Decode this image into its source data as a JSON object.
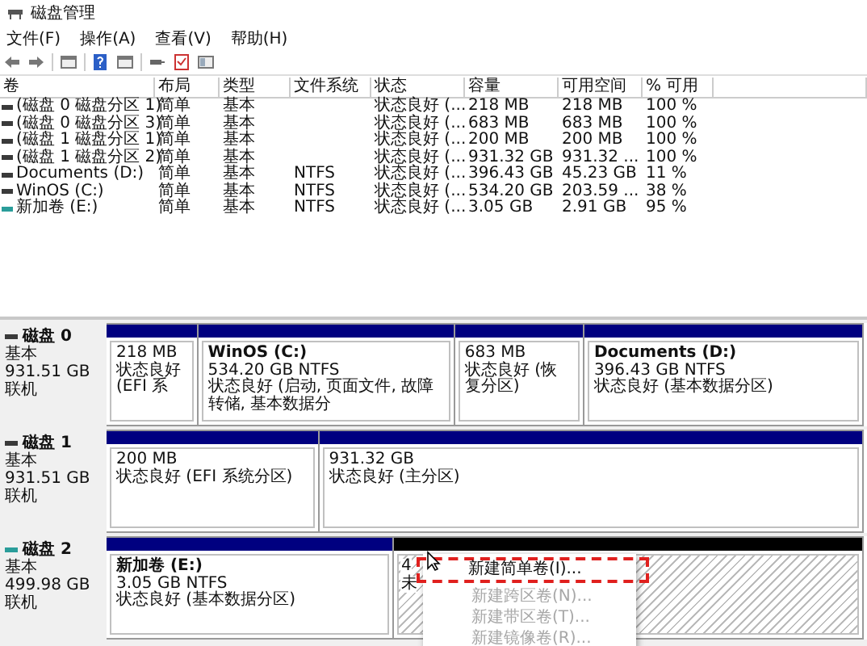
{
  "window": {
    "title": "磁盘管理"
  },
  "menu": [
    "文件(F)",
    "操作(A)",
    "查看(V)",
    "帮助(H)"
  ],
  "table": {
    "columns": [
      "卷",
      "布局",
      "类型",
      "文件系统",
      "状态",
      "容量",
      "可用空间",
      "% 可用"
    ],
    "rows": [
      {
        "color": "#3a3a3a",
        "cells": [
          "(磁盘 0 磁盘分区 1)",
          "简单",
          "基本",
          "",
          "状态良好 (...",
          "218 MB",
          "218 MB",
          "100 %"
        ]
      },
      {
        "color": "#3a3a3a",
        "cells": [
          "(磁盘 0 磁盘分区 3)",
          "简单",
          "基本",
          "",
          "状态良好 (...",
          "683 MB",
          "683 MB",
          "100 %"
        ]
      },
      {
        "color": "#3a3a3a",
        "cells": [
          "(磁盘 1 磁盘分区 1)",
          "简单",
          "基本",
          "",
          "状态良好 (...",
          "200 MB",
          "200 MB",
          "100 %"
        ]
      },
      {
        "color": "#3a3a3a",
        "cells": [
          "(磁盘 1 磁盘分区 2)",
          "简单",
          "基本",
          "",
          "状态良好 (...",
          "931.32 GB",
          "931.32 ...",
          "100 %"
        ]
      },
      {
        "color": "#3a3a3a",
        "cells": [
          "Documents (D:)",
          "简单",
          "基本",
          "NTFS",
          "状态良好 (...",
          "396.43 GB",
          "45.23 GB",
          "11 %"
        ]
      },
      {
        "color": "#3a3a3a",
        "cells": [
          "WinOS (C:)",
          "简单",
          "基本",
          "NTFS",
          "状态良好 (...",
          "534.20 GB",
          "203.59 ...",
          "38 %"
        ]
      },
      {
        "color": "#2a9d9a",
        "cells": [
          "新加卷 (E:)",
          "简单",
          "基本",
          "NTFS",
          "状态良好 (...",
          "3.05 GB",
          "2.91 GB",
          "95 %"
        ]
      }
    ]
  },
  "disks": [
    {
      "name": "磁盘 0",
      "color": "#3a3a3a",
      "type": "基本",
      "size": "931.51 GB",
      "status": "联机",
      "partitions": [
        {
          "kind": "primary",
          "lines": [
            "218 MB",
            "状态良好 (EFI 系"
          ]
        },
        {
          "kind": "primary",
          "title": "WinOS (C:)",
          "lines": [
            "534.20 GB NTFS",
            "状态良好 (启动, 页面文件, 故障转储, 基本数据分"
          ]
        },
        {
          "kind": "primary",
          "lines": [
            "683 MB",
            "状态良好 (恢复分区)"
          ]
        },
        {
          "kind": "primary",
          "title": "Documents (D:)",
          "lines": [
            "396.43 GB NTFS",
            "状态良好 (基本数据分区)"
          ]
        }
      ]
    },
    {
      "name": "磁盘 1",
      "color": "#3a3a3a",
      "type": "基本",
      "size": "931.51 GB",
      "status": "联机",
      "partitions": [
        {
          "kind": "primary",
          "lines": [
            "200 MB",
            "状态良好 (EFI 系统分区)"
          ]
        },
        {
          "kind": "primary",
          "lines": [
            "931.32 GB",
            "状态良好 (主分区)"
          ]
        }
      ]
    },
    {
      "name": "磁盘 2",
      "color": "#2a9d9a",
      "type": "基本",
      "size": "499.98 GB",
      "status": "联机",
      "partitions": [
        {
          "kind": "primary",
          "title": "新加卷 (E:)",
          "lines": [
            "3.05 GB NTFS",
            "状态良好 (基本数据分区)"
          ]
        },
        {
          "kind": "unallocated",
          "lines": [
            "4",
            "未"
          ]
        }
      ]
    }
  ],
  "context_menu": [
    {
      "label": "新建简单卷(I)...",
      "disabled": false,
      "selected": true
    },
    {
      "label": "新建跨区卷(N)...",
      "disabled": true,
      "selected": false
    },
    {
      "label": "新建带区卷(T)...",
      "disabled": true,
      "selected": false
    },
    {
      "label": "新建镜像卷(R)...",
      "disabled": true,
      "selected": false
    }
  ]
}
